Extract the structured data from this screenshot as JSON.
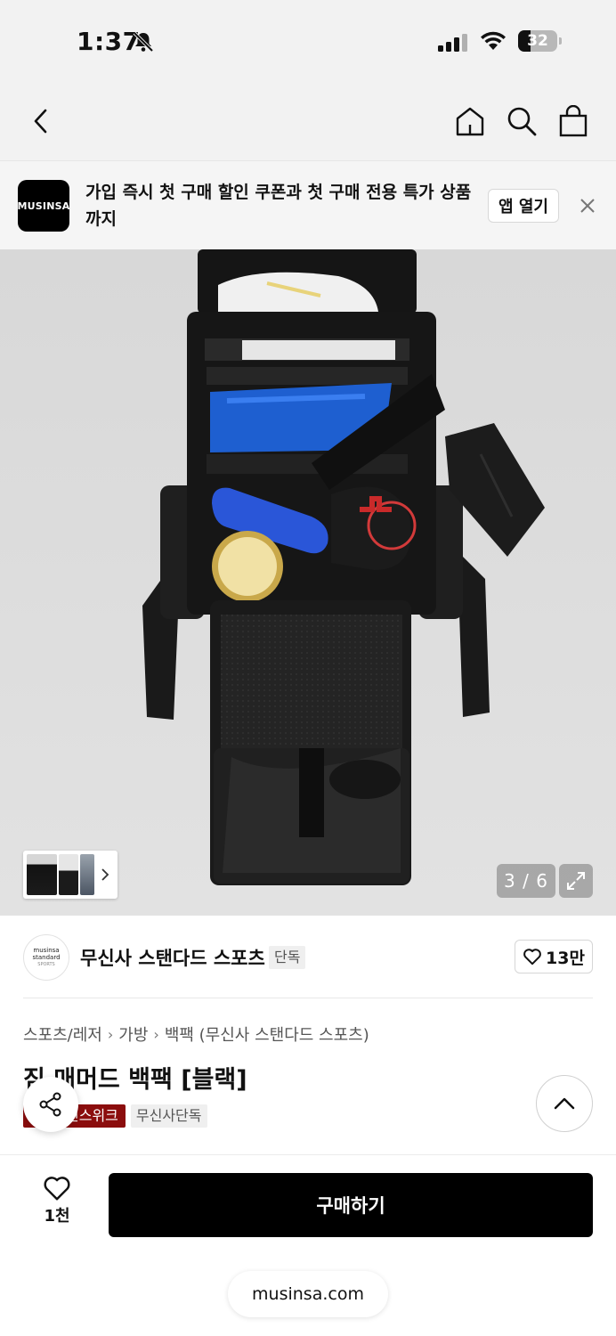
{
  "status_bar": {
    "time": "1:37",
    "battery_level": "32",
    "battery_fraction": 0.32
  },
  "nav": {
    "icons": [
      "back-icon",
      "home-icon",
      "search-icon",
      "cart-icon"
    ]
  },
  "app_banner": {
    "logo_text": "MUSINSA",
    "message": "가입 즉시 첫 구매 할인 쿠폰과 첫 구매 전용 특가 상품까지",
    "open_label": "앱 열기"
  },
  "gallery": {
    "counter": "3 / 6"
  },
  "brand": {
    "avatar_lines": [
      "musinsa",
      "standard",
      "SPORTS"
    ],
    "name": "무신사 스탠다드 스포츠",
    "badge": "단독",
    "likes": "13만"
  },
  "breadcrumb": [
    "스포츠/레저",
    "가방",
    "백팩 (무신사 스탠다드 스포츠)"
  ],
  "product": {
    "title": "짐 매머드 백팩 [블랙]",
    "tags": [
      "선스위크",
      "무신사단독"
    ]
  },
  "bottom_bar": {
    "wish_count": "1천",
    "buy_label": "구매하기"
  },
  "browser": {
    "url": "musinsa.com"
  },
  "colors": {
    "accent": "#000000",
    "tag_red": "#8b0d0d",
    "chrome_bg": "#f2f2f2"
  }
}
